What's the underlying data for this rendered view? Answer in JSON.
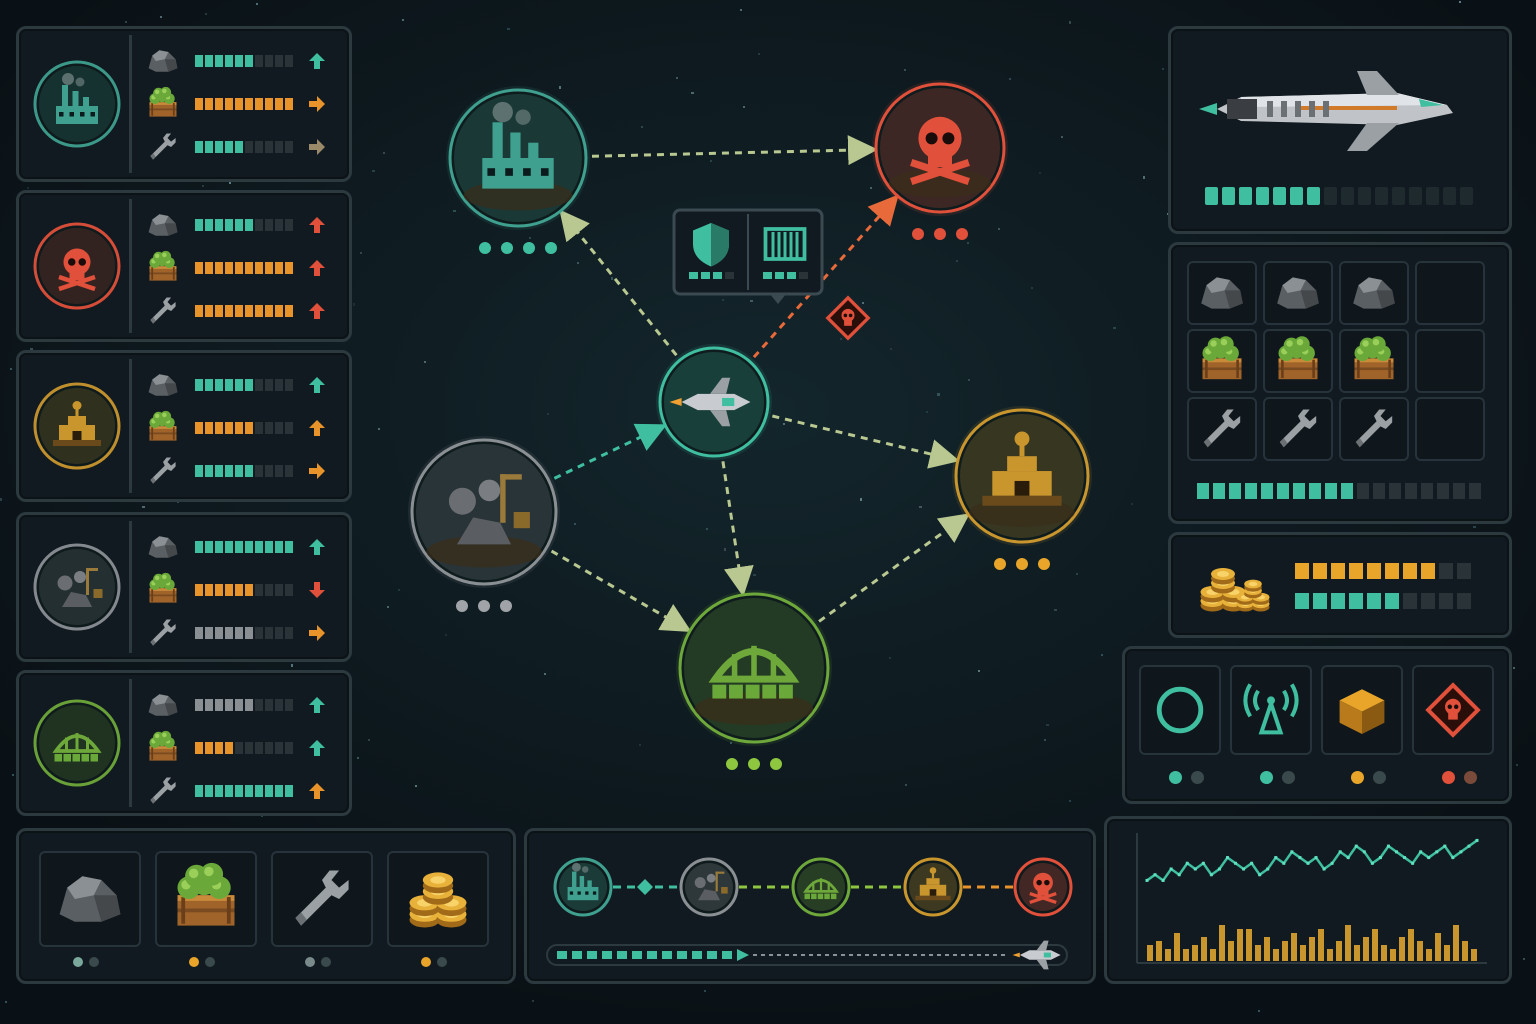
{
  "colors": {
    "teal": "#3fbfa0",
    "orange": "#e8942a",
    "red": "#e0503a",
    "green": "#8ec63f",
    "gold": "#c9962e",
    "grey": "#8a8f94",
    "dim": "#2a3338",
    "panel_border": "#2c3a40"
  },
  "resources": [
    "ore",
    "crops",
    "parts",
    "coins"
  ],
  "planet_list": [
    {
      "id": "industrial",
      "icon": "factory-icon",
      "color": "#3fa08f",
      "rows": [
        {
          "resource": "ore",
          "bar_color": "#3fbfa0",
          "level": 0.6,
          "trend": "up",
          "trend_color": "#3fbfa0"
        },
        {
          "resource": "crops",
          "bar_color": "#e8942a",
          "level": 1.0,
          "trend": "right",
          "trend_color": "#e8942a"
        },
        {
          "resource": "parts",
          "bar_color": "#3fbfa0",
          "level": 0.5,
          "trend": "right",
          "trend_color": "#9a8a6a"
        }
      ]
    },
    {
      "id": "pirate",
      "icon": "skull-icon",
      "color": "#e0503a",
      "rows": [
        {
          "resource": "ore",
          "bar_color": "#3fbfa0",
          "level": 0.6,
          "trend": "up",
          "trend_color": "#e0503a"
        },
        {
          "resource": "crops",
          "bar_color": "#e8942a",
          "level": 1.0,
          "trend": "up",
          "trend_color": "#e0503a"
        },
        {
          "resource": "parts",
          "bar_color": "#e8942a",
          "level": 1.0,
          "trend": "up",
          "trend_color": "#e0503a"
        }
      ]
    },
    {
      "id": "desert-outpost",
      "icon": "outpost-icon",
      "color": "#c9962e",
      "rows": [
        {
          "resource": "ore",
          "bar_color": "#3fbfa0",
          "level": 0.6,
          "trend": "up",
          "trend_color": "#3fbfa0"
        },
        {
          "resource": "crops",
          "bar_color": "#e8942a",
          "level": 0.6,
          "trend": "up",
          "trend_color": "#e8942a"
        },
        {
          "resource": "parts",
          "bar_color": "#3fbfa0",
          "level": 0.6,
          "trend": "right",
          "trend_color": "#e8942a"
        }
      ]
    },
    {
      "id": "mining",
      "icon": "mining-icon",
      "color": "#8a8f94",
      "rows": [
        {
          "resource": "ore",
          "bar_color": "#3fbfa0",
          "level": 1.0,
          "trend": "up",
          "trend_color": "#3fbfa0"
        },
        {
          "resource": "crops",
          "bar_color": "#e8942a",
          "level": 0.6,
          "trend": "down",
          "trend_color": "#e0503a"
        },
        {
          "resource": "parts",
          "bar_color": "#8a8f94",
          "level": 0.6,
          "trend": "right",
          "trend_color": "#e8942a"
        }
      ]
    },
    {
      "id": "agricultural",
      "icon": "greenhouse-icon",
      "color": "#6ea83a",
      "rows": [
        {
          "resource": "ore",
          "bar_color": "#8a8f94",
          "level": 0.6,
          "trend": "up",
          "trend_color": "#3fbfa0"
        },
        {
          "resource": "crops",
          "bar_color": "#e8942a",
          "level": 0.4,
          "trend": "up",
          "trend_color": "#3fbfa0"
        },
        {
          "resource": "parts",
          "bar_color": "#3fbfa0",
          "level": 1.0,
          "trend": "up",
          "trend_color": "#e8942a"
        }
      ]
    }
  ],
  "map": {
    "nodes": [
      {
        "id": "industrial",
        "icon": "factory-icon",
        "color": "#3fa08f",
        "dots": 4,
        "dot_color": "#3fbfa0"
      },
      {
        "id": "pirate",
        "icon": "skull-icon",
        "color": "#e0503a",
        "dots": 3,
        "dot_color": "#e0503a"
      },
      {
        "id": "ship",
        "icon": "spaceship-icon",
        "color": "#3fbfa0",
        "dots": 0,
        "dot_color": "#3fbfa0"
      },
      {
        "id": "mining",
        "icon": "mining-icon",
        "color": "#8a8f94",
        "dots": 3,
        "dot_color": "#a0a4a8"
      },
      {
        "id": "desert-outpost",
        "icon": "outpost-icon",
        "color": "#c9962e",
        "dots": 3,
        "dot_color": "#e8a52a"
      },
      {
        "id": "agricultural",
        "icon": "greenhouse-icon",
        "color": "#6ea83a",
        "dots": 3,
        "dot_color": "#8ec63f"
      }
    ],
    "routes": [
      {
        "from": "industrial",
        "to": "pirate",
        "style": "safe"
      },
      {
        "from": "ship",
        "to": "industrial",
        "style": "safe"
      },
      {
        "from": "ship",
        "to": "pirate",
        "style": "danger"
      },
      {
        "from": "ship",
        "to": "desert-outpost",
        "style": "safe"
      },
      {
        "from": "ship",
        "to": "agricultural",
        "style": "safe"
      },
      {
        "from": "mining",
        "to": "ship",
        "style": "active"
      },
      {
        "from": "mining",
        "to": "agricultural",
        "style": "safe"
      },
      {
        "from": "agricultural",
        "to": "desert-outpost",
        "style": "safe"
      }
    ],
    "hazard": {
      "icon": "skull-warning-icon"
    },
    "tooltip": {
      "items": [
        {
          "icon": "shield-icon",
          "level": 0.75
        },
        {
          "icon": "cargo-container-icon",
          "level": 0.75
        }
      ]
    }
  },
  "ship_panel": {
    "icon": "spaceship-icon",
    "hull": 0.45
  },
  "cargo": {
    "grid": [
      [
        "ore",
        "ore",
        "ore",
        "empty"
      ],
      [
        "crops",
        "crops",
        "crops",
        "empty"
      ],
      [
        "parts",
        "parts",
        "parts",
        "empty"
      ]
    ],
    "capacity": 0.55
  },
  "credits": {
    "icon": "coin-stack-icon",
    "gold_level": 0.8,
    "teal_level": 0.6
  },
  "status": [
    {
      "icon": "scanner-ring-icon",
      "dots": [
        "#3fbfa0",
        "#3a4a4c"
      ]
    },
    {
      "icon": "signal-tower-icon",
      "dots": [
        "#3fbfa0",
        "#3a4a4c"
      ]
    },
    {
      "icon": "cargo-crate-icon",
      "dots": [
        "#e8a52a",
        "#3a4a4c"
      ]
    },
    {
      "icon": "danger-skull-icon",
      "dots": [
        "#e0503a",
        "#7a4a3a"
      ]
    }
  ],
  "inventory": [
    {
      "resource": "ore",
      "icon": "ore-icon",
      "dots": [
        "#7aa89a",
        "#3a4a4c"
      ]
    },
    {
      "resource": "crops",
      "icon": "crops-crate-icon",
      "dots": [
        "#e8a52a",
        "#3a4a4c"
      ]
    },
    {
      "resource": "parts",
      "icon": "wrench-icon",
      "dots": [
        "#7a8a8a",
        "#3a4a4c"
      ]
    },
    {
      "resource": "coins",
      "icon": "coins-icon",
      "dots": [
        "#e8a52a",
        "#3a4a4c"
      ]
    }
  ],
  "route_plan": {
    "stops": [
      {
        "icon": "factory-icon",
        "color": "#3fa08f"
      },
      {
        "icon": "mining-icon",
        "color": "#8a8f94"
      },
      {
        "icon": "greenhouse-icon",
        "color": "#6ea83a"
      },
      {
        "icon": "outpost-icon",
        "color": "#c9962e"
      },
      {
        "icon": "skull-icon",
        "color": "#e0503a"
      }
    ],
    "connector_colors": [
      "#3fbfa0",
      "#8ec63f",
      "#8ec63f",
      "#e8942a"
    ],
    "progress": 0.6
  },
  "market_chart": {
    "line": [
      5,
      6,
      5,
      7,
      6,
      8,
      7,
      8,
      6,
      7,
      9,
      8,
      7,
      8,
      6,
      7,
      9,
      8,
      10,
      9,
      8,
      9,
      7,
      8,
      10,
      9,
      11,
      10,
      8,
      9,
      11,
      10,
      9,
      8,
      10,
      9,
      10,
      11,
      9,
      10,
      11,
      12
    ],
    "bars": [
      4,
      5,
      3,
      7,
      3,
      4,
      6,
      3,
      9,
      5,
      8,
      8,
      4,
      6,
      3,
      5,
      7,
      4,
      6,
      8,
      3,
      5,
      9,
      4,
      6,
      8,
      4,
      3,
      6,
      8,
      5,
      3,
      7,
      4,
      9,
      5,
      3
    ]
  }
}
